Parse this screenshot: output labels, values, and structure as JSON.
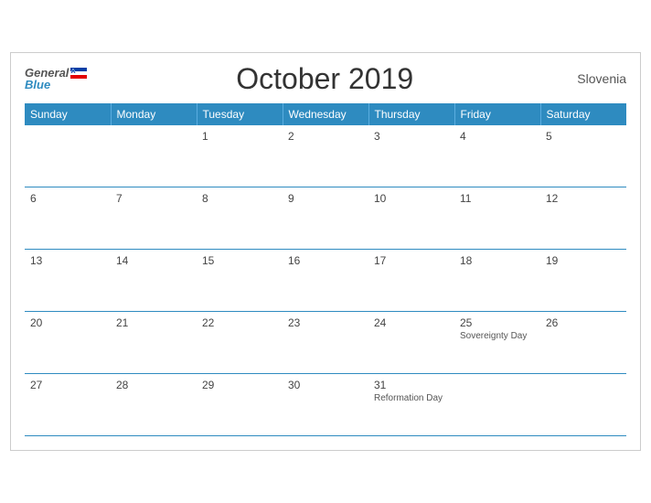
{
  "header": {
    "logo_general": "General",
    "logo_blue": "Blue",
    "title": "October 2019",
    "country": "Slovenia"
  },
  "weekdays": [
    "Sunday",
    "Monday",
    "Tuesday",
    "Wednesday",
    "Thursday",
    "Friday",
    "Saturday"
  ],
  "weeks": [
    [
      {
        "day": "",
        "holiday": ""
      },
      {
        "day": "",
        "holiday": ""
      },
      {
        "day": "1",
        "holiday": ""
      },
      {
        "day": "2",
        "holiday": ""
      },
      {
        "day": "3",
        "holiday": ""
      },
      {
        "day": "4",
        "holiday": ""
      },
      {
        "day": "5",
        "holiday": ""
      }
    ],
    [
      {
        "day": "6",
        "holiday": ""
      },
      {
        "day": "7",
        "holiday": ""
      },
      {
        "day": "8",
        "holiday": ""
      },
      {
        "day": "9",
        "holiday": ""
      },
      {
        "day": "10",
        "holiday": ""
      },
      {
        "day": "11",
        "holiday": ""
      },
      {
        "day": "12",
        "holiday": ""
      }
    ],
    [
      {
        "day": "13",
        "holiday": ""
      },
      {
        "day": "14",
        "holiday": ""
      },
      {
        "day": "15",
        "holiday": ""
      },
      {
        "day": "16",
        "holiday": ""
      },
      {
        "day": "17",
        "holiday": ""
      },
      {
        "day": "18",
        "holiday": ""
      },
      {
        "day": "19",
        "holiday": ""
      }
    ],
    [
      {
        "day": "20",
        "holiday": ""
      },
      {
        "day": "21",
        "holiday": ""
      },
      {
        "day": "22",
        "holiday": ""
      },
      {
        "day": "23",
        "holiday": ""
      },
      {
        "day": "24",
        "holiday": ""
      },
      {
        "day": "25",
        "holiday": "Sovereignty Day"
      },
      {
        "day": "26",
        "holiday": ""
      }
    ],
    [
      {
        "day": "27",
        "holiday": ""
      },
      {
        "day": "28",
        "holiday": ""
      },
      {
        "day": "29",
        "holiday": ""
      },
      {
        "day": "30",
        "holiday": ""
      },
      {
        "day": "31",
        "holiday": "Reformation Day"
      },
      {
        "day": "",
        "holiday": ""
      },
      {
        "day": "",
        "holiday": ""
      }
    ]
  ]
}
